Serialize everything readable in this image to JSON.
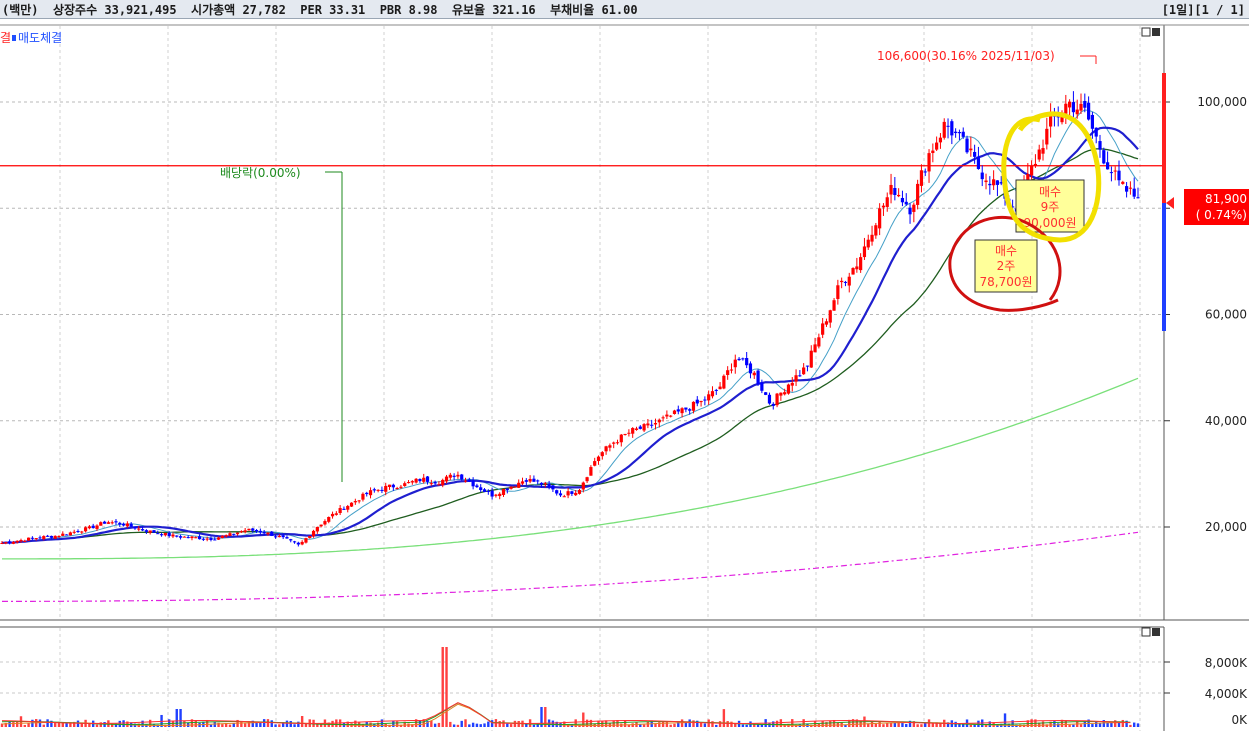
{
  "header": {
    "info": "(백만)  상장주수 33,921,495  시가총액 27,782  PER 33.31  PBR 8.98  유보율 321.16  부채비율 61.00",
    "period": "[1일][1 / 1]"
  },
  "legend": {
    "sell_fill": "매도체결",
    "left_fragment": "결"
  },
  "chart_data": {
    "type": "candlestick",
    "price_axis": {
      "ticks": [
        100000,
        80000,
        60000,
        40000,
        20000
      ],
      "tick_labels": [
        "100,000",
        "60,000",
        "40,000",
        "20,000"
      ],
      "ylim": [
        3000,
        113000
      ]
    },
    "volume_axis": {
      "ticks": [
        "8,000K",
        "4,000K",
        "0K"
      ]
    },
    "current_price": {
      "label": "81,900",
      "change": "( 0.74%)"
    },
    "reference_line": 88000,
    "high_annotation": "106,600(30.16% 2025/11/03)",
    "dividend_annotation": "배당락(0.00%)",
    "buy_markers": [
      {
        "label": "매수",
        "qty": "2주",
        "price": "78,700원"
      },
      {
        "label": "매수",
        "qty": "9주",
        "price": "90,000원"
      }
    ],
    "close_path": [
      17000,
      17500,
      18000,
      18300,
      19000,
      19800,
      21000,
      20500,
      19500,
      18800,
      18200,
      18000,
      17800,
      18500,
      19500,
      19000,
      18000,
      16500,
      20000,
      22500,
      24500,
      26500,
      27500,
      28000,
      29000,
      28500,
      30000,
      28000,
      26000,
      27500,
      29000,
      28000,
      26000,
      27000,
      33000,
      36000,
      38000,
      39000,
      40500,
      42000,
      43500,
      46000,
      52000,
      49000,
      43000,
      47000,
      50000,
      58000,
      66000,
      70000,
      78000,
      84000,
      80000,
      90000,
      96000,
      92000,
      87000,
      84000,
      80000,
      88000,
      96000,
      100000,
      98000,
      90000,
      84000,
      81900
    ],
    "colors": {
      "up": "#ff0000",
      "down": "#0000ff",
      "ma5": "#1f1fcf",
      "ma20": "#45a0c8",
      "ma60": "#1f5d1f",
      "ma120": "#7ae07a",
      "ma240": "#e022e0",
      "ref_line": "#ff0000",
      "dividend": "#1d8a1d",
      "circle_red": "#d01010",
      "circle_yellow": "#f2e000"
    }
  }
}
